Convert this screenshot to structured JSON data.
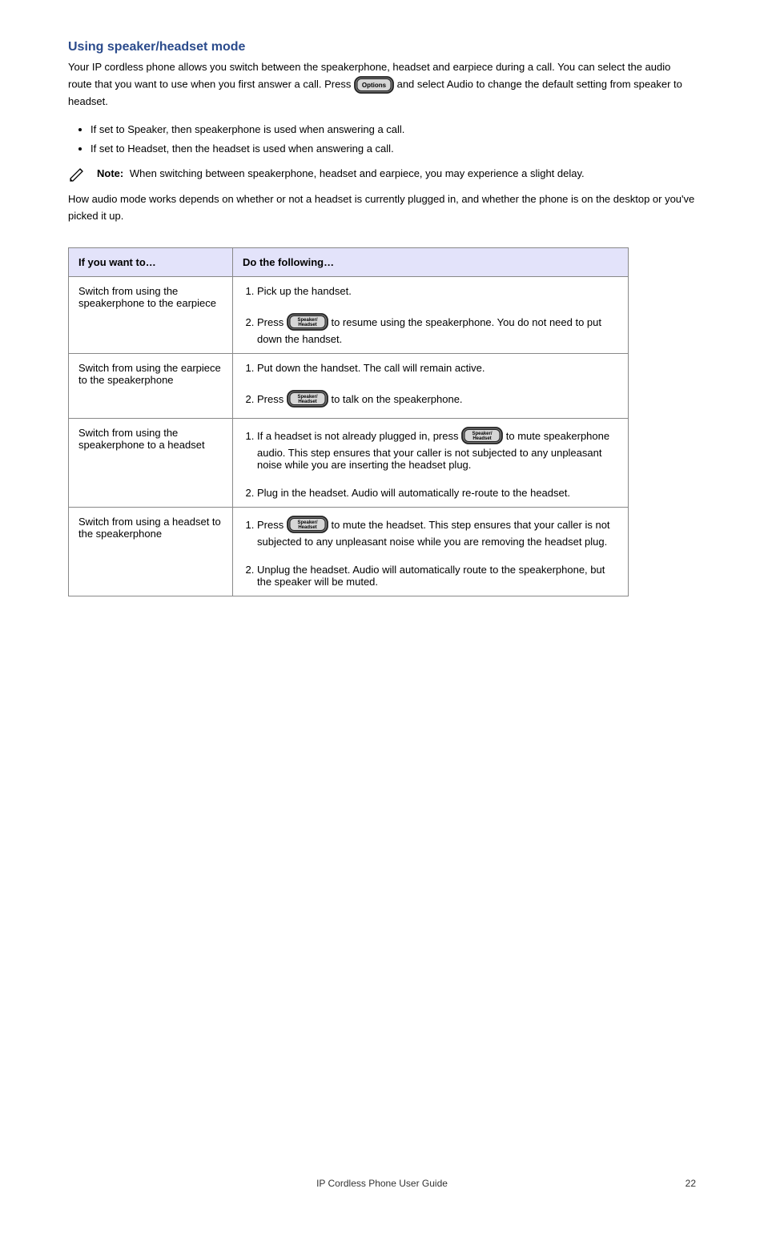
{
  "heading": "Using speaker/headset mode",
  "p1_a": "Your IP cordless phone allows you switch between the speakerphone, headset and earpiece during a call. You can select the audio route that you want to use when you first answer a call. Press  ",
  "p1_b": "  and select Audio to change the default setting from speaker to headset.",
  "list": [
    "If set to Speaker, then speakerphone is used when answering a call.",
    "If set to Headset, then the headset is used when answering a call."
  ],
  "note_label": "Note:",
  "note_text": "When switching between speakerphone, headset and earpiece, you may experience a slight delay.",
  "p2": "How audio mode works depends on whether or not a headset is currently plugged in, and whether the phone is on the desktop or you've picked it up.",
  "table": {
    "headers": [
      "If you want to…",
      "Do the following…"
    ],
    "rows": [
      {
        "left": "Switch from using the speakerphone to the earpiece",
        "r1": "Pick up the handset.",
        "r2a": "Press  ",
        "r2b": "  to resume using the speakerphone. You do not need to put down the handset."
      },
      {
        "left": "Switch from using the earpiece to the speakerphone",
        "r1": "Put down the handset. The call will remain active.",
        "r2a": "Press  ",
        "r2b": "  to talk on the speakerphone."
      },
      {
        "left": "Switch from using the speakerphone to a headset",
        "r1a": "If a headset is not already plugged in, press  ",
        "r1b": "  to mute speakerphone audio. This step ensures that your caller is not subjected to any unpleasant noise while you are inserting the headset plug.",
        "r2": "Plug in the headset. Audio will automatically re-route to the headset."
      },
      {
        "left": "Switch from using a headset to the speakerphone",
        "r1a": "Press  ",
        "r1b": "  to mute the headset. This step ensures that your caller is not subjected to any unpleasant noise while you are removing the headset plug.",
        "r2": "Unplug the headset. Audio will automatically route to the speakerphone, but the speaker will be muted."
      }
    ]
  },
  "footer_center": "IP Cordless Phone User Guide",
  "footer_page": "22",
  "icons": {
    "options_label": "Options",
    "speaker_label": "Speaker/\nHeadset"
  }
}
